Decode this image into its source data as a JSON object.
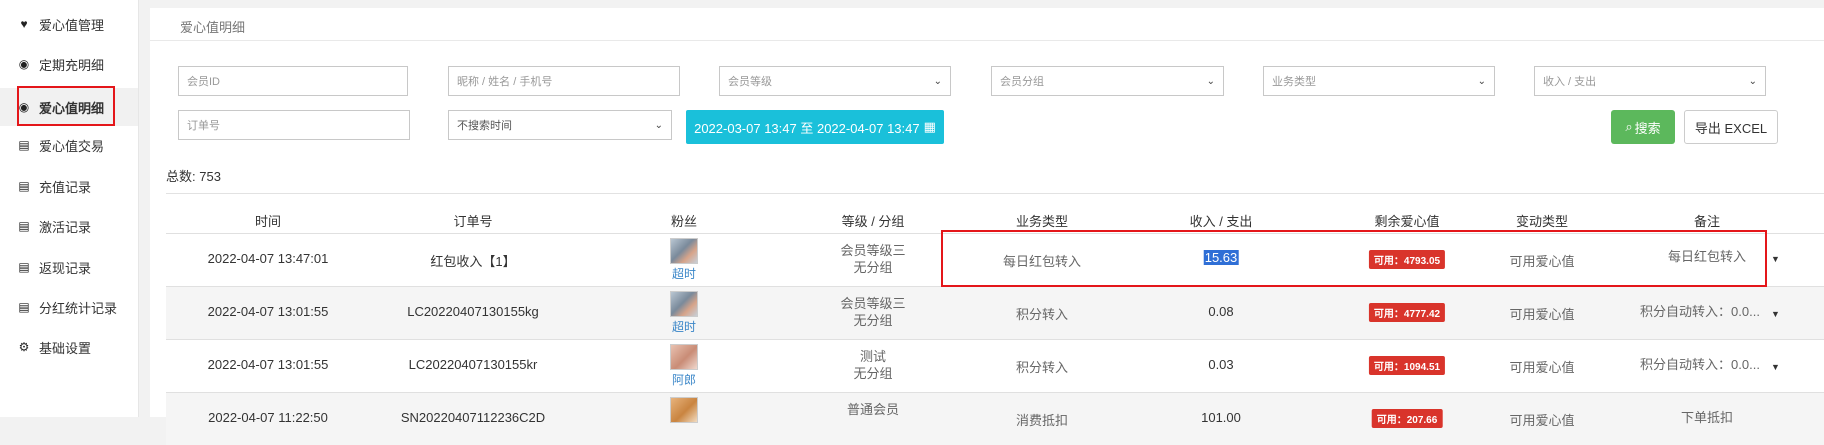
{
  "sidebar": {
    "items": [
      {
        "label": "爱心值管理",
        "icon": "heart-icon"
      },
      {
        "label": "定期充明细",
        "icon": "heart-circle-icon"
      },
      {
        "label": "爱心值明细",
        "icon": "heart-circle-icon"
      },
      {
        "label": "爱心值交易",
        "icon": "document-icon"
      },
      {
        "label": "充值记录",
        "icon": "document-icon"
      },
      {
        "label": "激活记录",
        "icon": "document-icon"
      },
      {
        "label": "返现记录",
        "icon": "document-icon"
      },
      {
        "label": "分红统计记录",
        "icon": "document-icon"
      },
      {
        "label": "基础设置",
        "icon": "gears-icon"
      }
    ],
    "active_index": 2
  },
  "breadcrumb": "爱心值明细",
  "filters": {
    "member_id_placeholder": "会员ID",
    "name_placeholder": "昵称 / 姓名 / 手机号",
    "member_level": "会员等级",
    "member_group": "会员分组",
    "business_type": "业务类型",
    "income_expense": "收入 / 支出",
    "order_placeholder": "订单号",
    "time_search": "不搜索时间",
    "date_range": "2022-03-07 13:47 至 2022-04-07 13:47",
    "search_label": "搜索",
    "export_label": "导出 EXCEL"
  },
  "total": {
    "label": "总数:",
    "value": "753"
  },
  "table": {
    "columns": [
      "时间",
      "订单号",
      "粉丝",
      "等级 / 分组",
      "业务类型",
      "收入 / 支出",
      "剩余爱心值",
      "变动类型",
      "备注"
    ],
    "rows": [
      {
        "time": "2022-04-07 13:47:01",
        "order": "红包收入【1】",
        "fan": "超时",
        "level": "会员等级三",
        "group": "无分组",
        "business": "每日红包转入",
        "amount": "15.63",
        "remaining": "可用：4793.05",
        "change": "可用爱心值",
        "remark": "每日红包转入"
      },
      {
        "time": "2022-04-07 13:01:55",
        "order": "LC20220407130155kg",
        "fan": "超时",
        "level": "会员等级三",
        "group": "无分组",
        "business": "积分转入",
        "amount": "0.08",
        "remaining": "可用：4777.42",
        "change": "可用爱心值",
        "remark": "积分自动转入：0.0..."
      },
      {
        "time": "2022-04-07 13:01:55",
        "order": "LC20220407130155kr",
        "fan": "阿郎",
        "level": "测试",
        "group": "无分组",
        "business": "积分转入",
        "amount": "0.03",
        "remaining": "可用：1094.51",
        "change": "可用爱心值",
        "remark": "积分自动转入：0.0..."
      },
      {
        "time": "2022-04-07 11:22:50",
        "order": "SN20220407112236C2D",
        "fan": "",
        "level": "普通会员",
        "group": "",
        "business": "消费抵扣",
        "amount": "101.00",
        "remaining": "可用：207.66",
        "change": "可用爱心值",
        "remark": "下单抵扣"
      }
    ]
  }
}
